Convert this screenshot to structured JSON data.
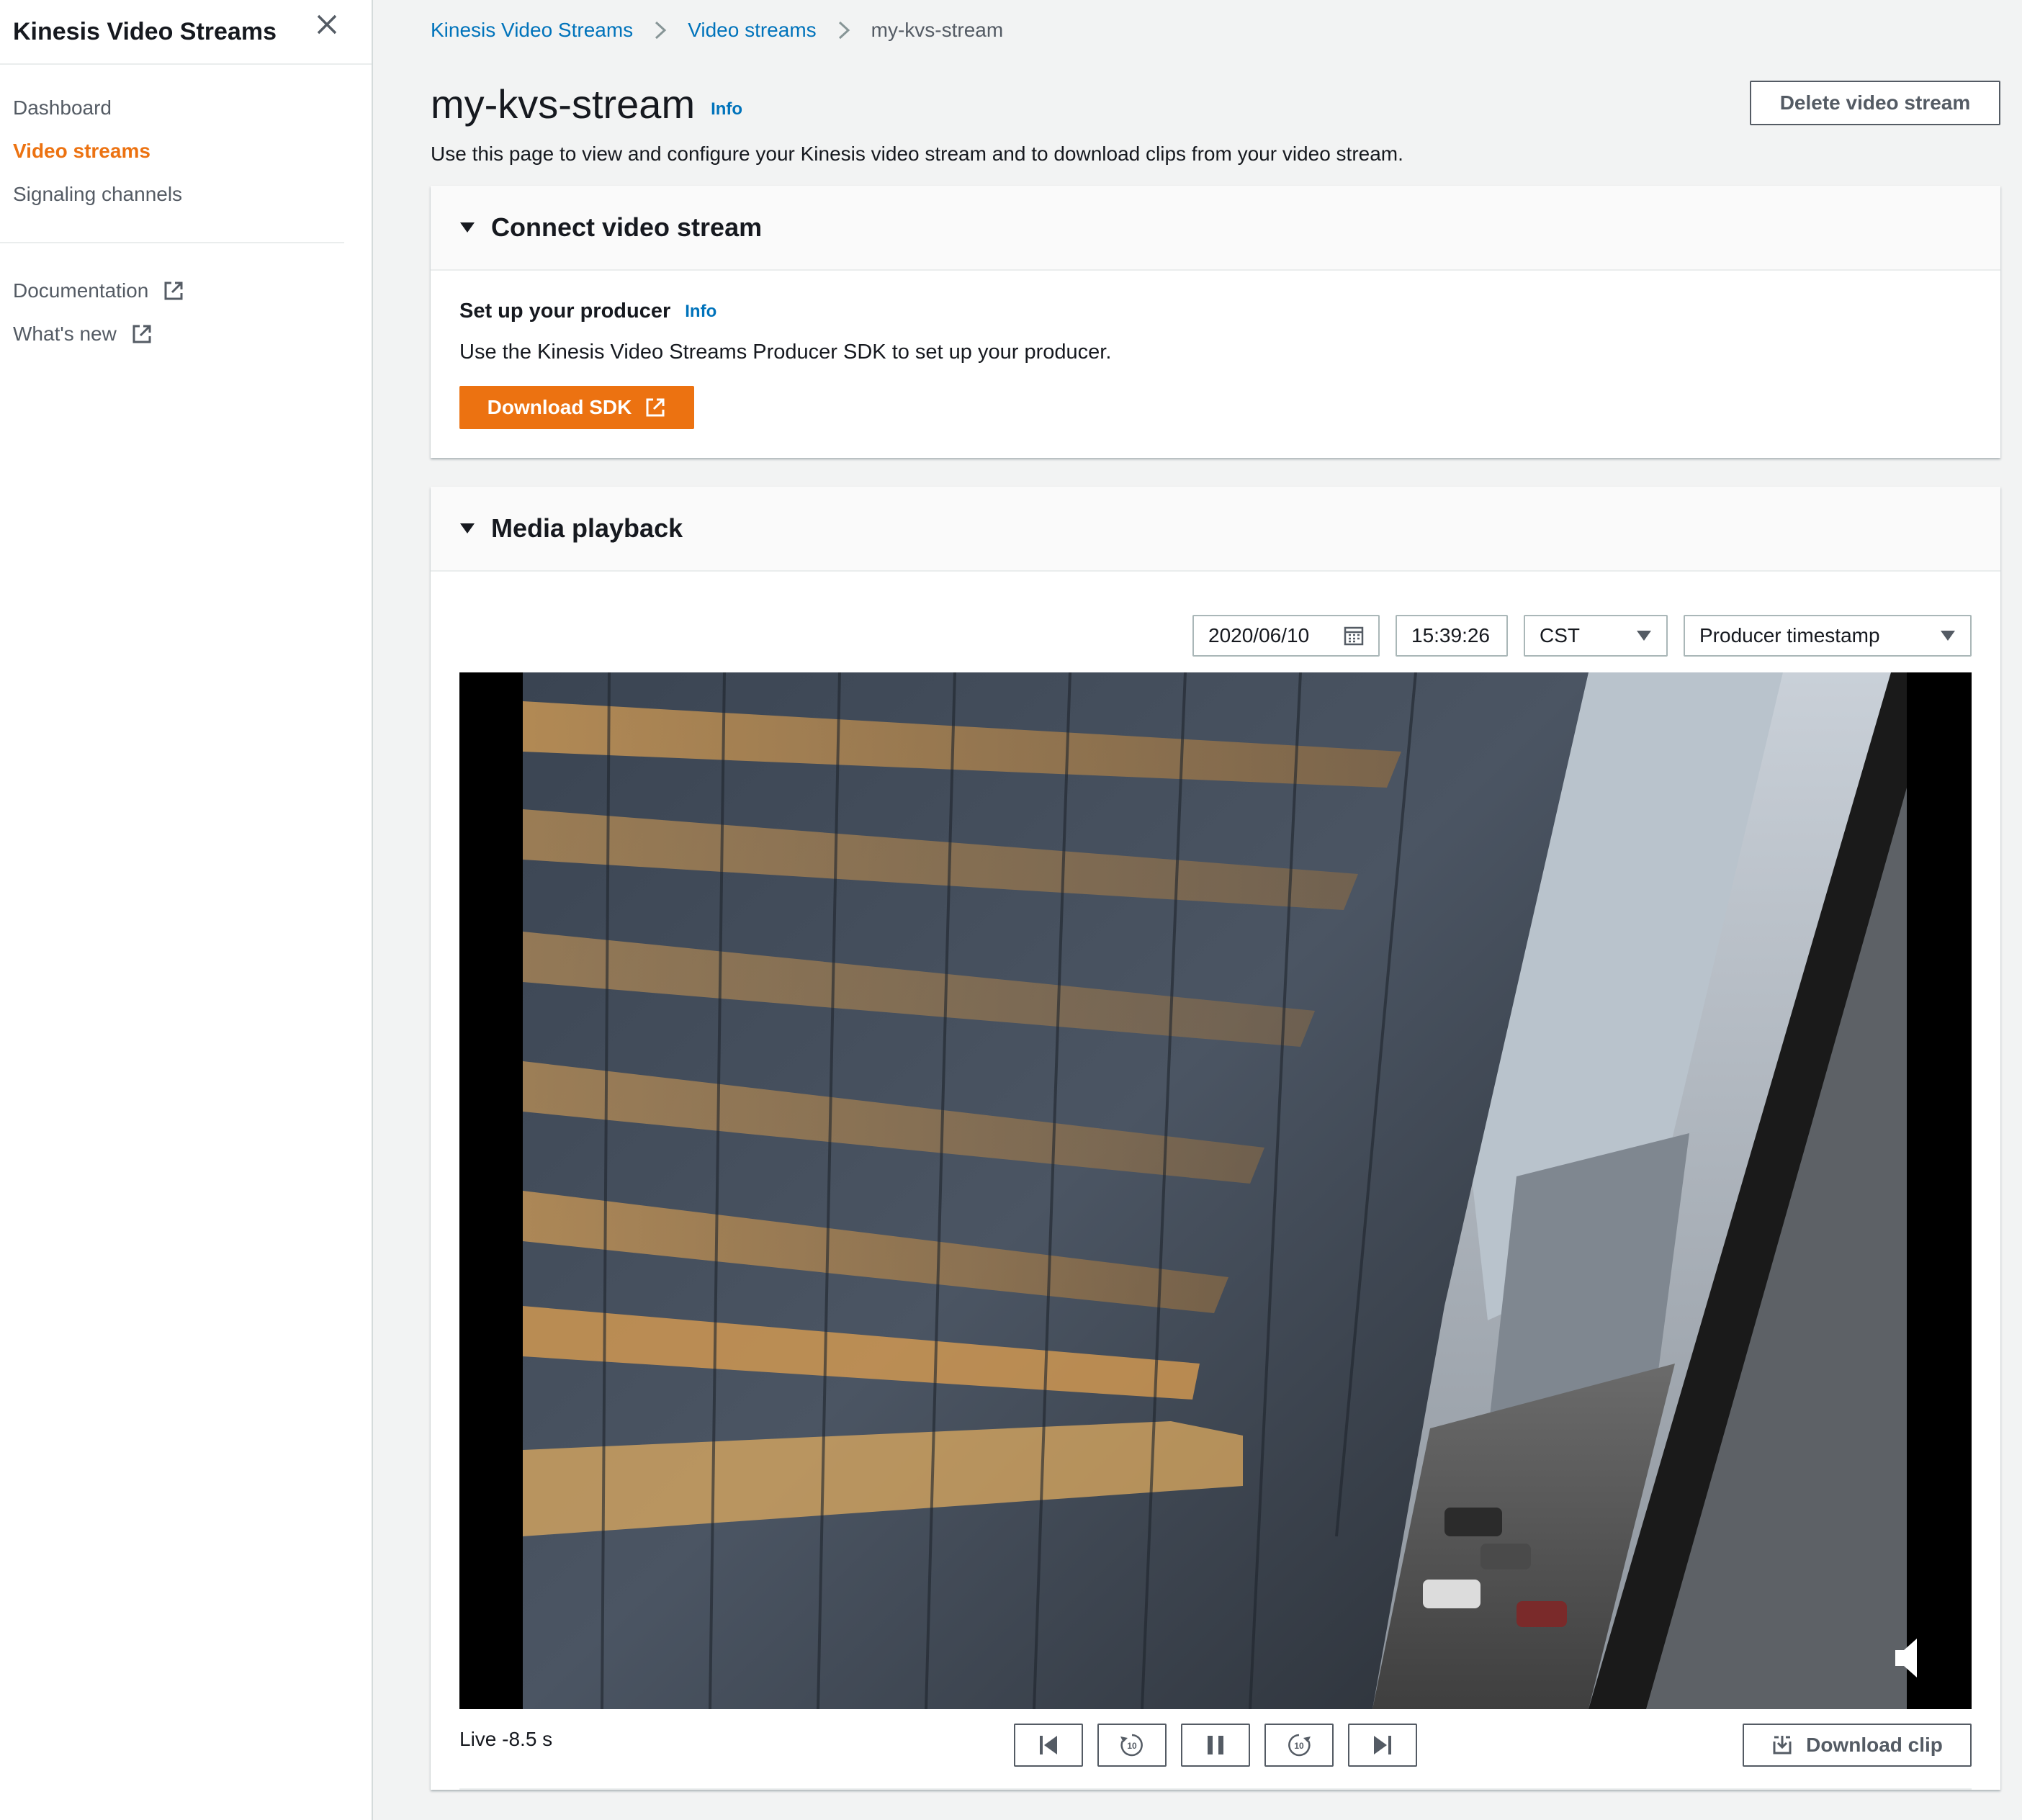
{
  "sidebar": {
    "title": "Kinesis Video Streams",
    "items": [
      {
        "label": "Dashboard"
      },
      {
        "label": "Video streams"
      },
      {
        "label": "Signaling channels"
      }
    ],
    "external": [
      {
        "label": "Documentation"
      },
      {
        "label": "What's new"
      }
    ]
  },
  "breadcrumb": {
    "items": [
      "Kinesis Video Streams",
      "Video streams",
      "my-kvs-stream"
    ]
  },
  "header": {
    "title": "my-kvs-stream",
    "info": "Info",
    "delete_label": "Delete video stream",
    "description": "Use this page to view and configure your Kinesis video stream and to download clips from your video stream."
  },
  "connect_panel": {
    "title": "Connect video stream",
    "subtitle": "Set up your producer",
    "info": "Info",
    "description": "Use the Kinesis Video Streams Producer SDK to set up your producer.",
    "button_label": "Download SDK"
  },
  "playback_panel": {
    "title": "Media playback",
    "date": "2020/06/10",
    "time": "15:39:26",
    "timezone": "CST",
    "timestamp_type": "Producer timestamp",
    "live_text": "Live -8.5 s",
    "download_clip_label": "Download clip",
    "skip_label": "10"
  },
  "colors": {
    "accent": "#ec7211",
    "link": "#0073bb",
    "background": "#f2f3f3"
  }
}
